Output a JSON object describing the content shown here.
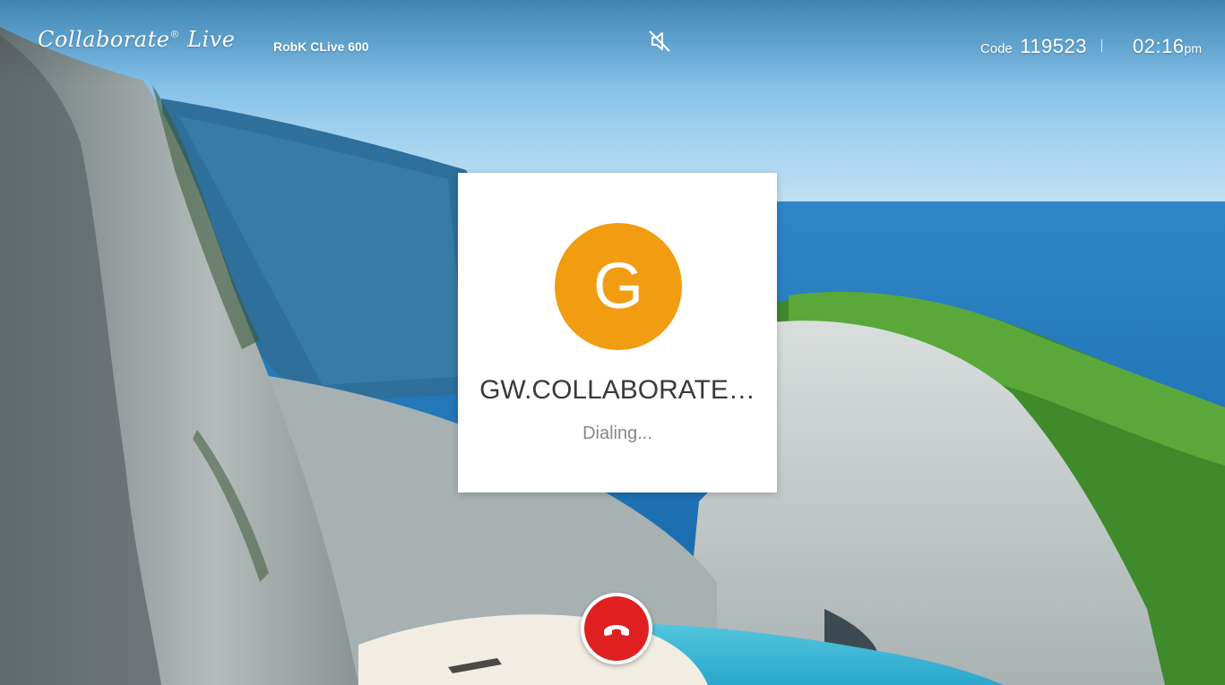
{
  "header": {
    "brand_name": "Collaborate",
    "brand_reg": "®",
    "brand_suffix": "Live",
    "device_name": "RobK CLive 600",
    "mute_icon": "speaker-muted-icon",
    "code_label": "Code",
    "code_value": "119523",
    "time": "02:16",
    "ampm": "pm"
  },
  "call": {
    "avatar_initial": "G",
    "avatar_color": "#f29c11",
    "callee_name": "GW.COLLABORATE…",
    "status": "Dialing..."
  },
  "controls": {
    "hangup_icon": "phone-hangup-icon",
    "hangup_color": "#e02020"
  }
}
